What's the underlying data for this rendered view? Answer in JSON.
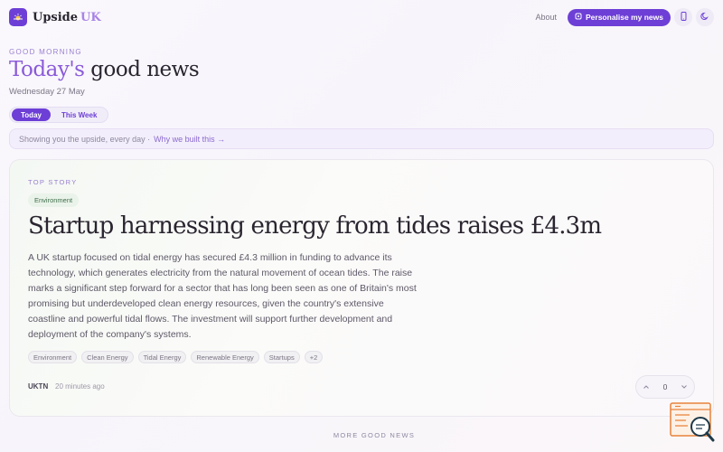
{
  "brand": {
    "name": "Upside",
    "suffix": "UK"
  },
  "nav": {
    "about": "About",
    "personalise": "Personalise my news"
  },
  "hero": {
    "greeting": "GOOD MORNING",
    "title_accent": "Today's",
    "title_rest": "good news",
    "date": "Wednesday 27 May"
  },
  "tabs": [
    {
      "label": "Today",
      "active": true
    },
    {
      "label": "This Week",
      "active": false
    }
  ],
  "banner": {
    "text": "Showing you the upside, every day ·",
    "link": "Why we built this →"
  },
  "top_story": {
    "kicker": "TOP STORY",
    "category": "Environment",
    "title": "Startup harnessing energy from tides raises £4.3m",
    "body": "A UK startup focused on tidal energy has secured £4.3 million in funding to advance its technology, which generates electricity from the natural movement of ocean tides. The raise marks a significant step forward for a sector that has long been seen as one of Britain's most promising but underdeveloped clean energy resources, given the country's extensive coastline and powerful tidal flows. The investment will support further development and deployment of the company's systems.",
    "tags": [
      "Environment",
      "Clean Energy",
      "Tidal Energy",
      "Renewable Energy",
      "Startups",
      "+2"
    ],
    "source": "UKTN",
    "time": "20 minutes ago",
    "votes": "0"
  },
  "more": "MORE GOOD NEWS",
  "colors": {
    "accent": "#6d3fd6",
    "accent_light": "#a883e6",
    "category_green": "#3f6e4a",
    "widget_orange": "#e8823a"
  },
  "icons": {
    "logo": "sun-icon",
    "personalise": "sparkle-icon",
    "phone": "phone-icon",
    "theme": "moon-icon",
    "up": "chevron-up-icon",
    "down": "chevron-down-icon",
    "feedback": "chat-search-icon"
  }
}
